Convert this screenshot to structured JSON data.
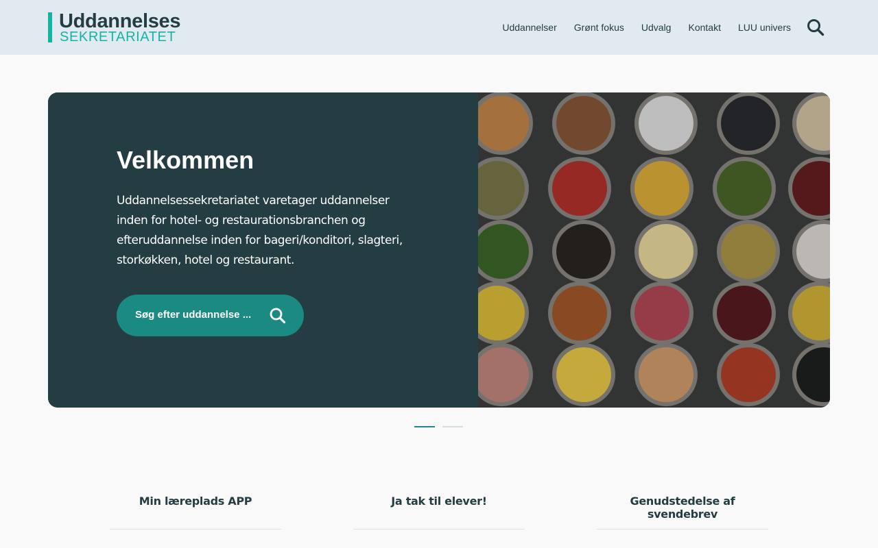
{
  "header": {
    "logo": {
      "line1": "Uddannelses",
      "line2": "SEKRETARIATET"
    },
    "nav": [
      {
        "label": "Uddannelser"
      },
      {
        "label": "Grønt fokus"
      },
      {
        "label": "Udvalg"
      },
      {
        "label": "Kontakt"
      },
      {
        "label": "LUU univers"
      }
    ],
    "search_icon": "search-icon"
  },
  "hero": {
    "title": "Velkommen",
    "text": "Uddannelsessekretariatet varetager uddannelser inden for hotel- og restaurationsbranchen og efteruddannelse inden for bageri/konditori, slagteri, storkøkken, hotel og restaurant.",
    "cta_label": "Søg efter uddannelse ...",
    "cta_icon": "search-icon",
    "image": "food-bowls-image"
  },
  "slider": {
    "count": 2,
    "active": 1
  },
  "links": [
    {
      "label": "Min læreplads APP"
    },
    {
      "label": "Ja tak til elever!"
    },
    {
      "label": "Genudstedelse af svendebrev"
    }
  ],
  "colors": {
    "header_bg": "#e1e9f1",
    "hero_bg": "#243d42",
    "accent": "#13b5a2",
    "button": "#1a8a82",
    "text_dark": "#243d42"
  }
}
